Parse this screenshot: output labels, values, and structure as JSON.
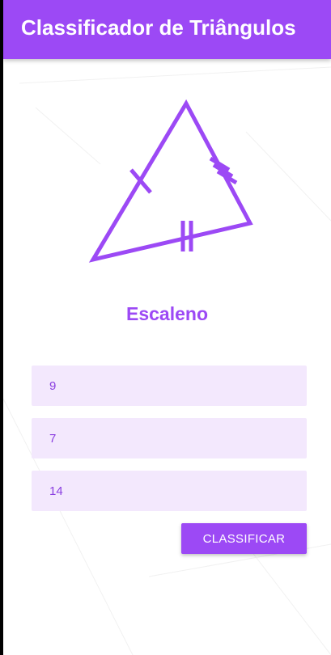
{
  "app_bar": {
    "title": "Classificador de Triângulos"
  },
  "illustration": {
    "icon": "scalene-triangle-icon",
    "color": "#9c49f5"
  },
  "result": {
    "label": "Escaleno"
  },
  "form": {
    "side_a": "9",
    "side_b": "7",
    "side_c": "14",
    "submit_label": "CLASSIFICAR"
  },
  "colors": {
    "primary": "#9c49f5",
    "field_background": "#f3e8fd",
    "field_text": "#8a3ee0"
  }
}
